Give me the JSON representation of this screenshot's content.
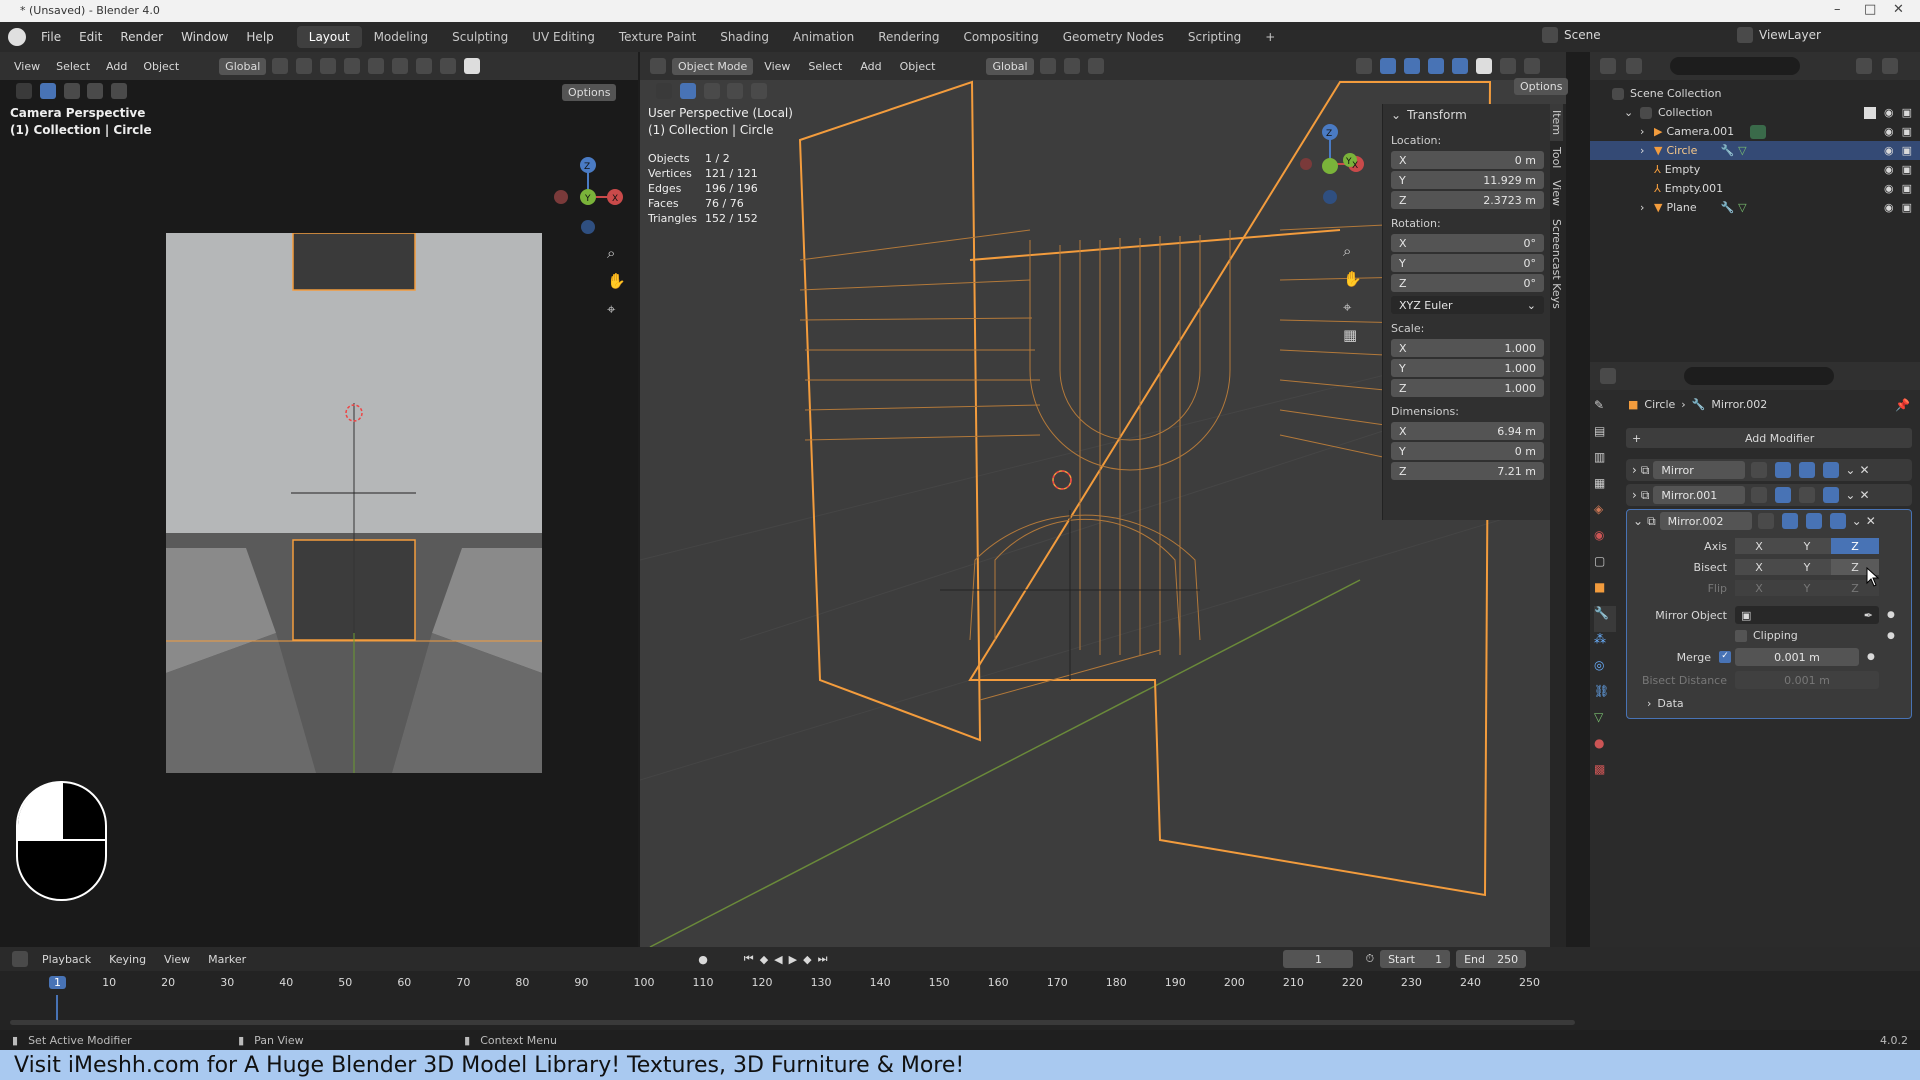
{
  "window": {
    "title": "* (Unsaved) - Blender 4.0"
  },
  "menu": [
    "File",
    "Edit",
    "Render",
    "Window",
    "Help"
  ],
  "workspaces": [
    "Layout",
    "Modeling",
    "Sculpting",
    "UV Editing",
    "Texture Paint",
    "Shading",
    "Animation",
    "Rendering",
    "Compositing",
    "Geometry Nodes",
    "Scripting"
  ],
  "workspace_add": "+",
  "scene": {
    "label": "Scene",
    "viewlayer": "ViewLayer"
  },
  "cam_view": {
    "menu": [
      "View",
      "Select",
      "Add",
      "Object"
    ],
    "transform": "Global",
    "options": "Options",
    "line1": "Camera Perspective",
    "line2": "(1) Collection | Circle"
  },
  "main_view": {
    "mode": "Object Mode",
    "menu": [
      "View",
      "Select",
      "Add",
      "Object"
    ],
    "transform": "Global",
    "options": "Options",
    "line1": "User Perspective (Local)",
    "line2": "(1) Collection | Circle",
    "stats": [
      {
        "k": "Objects",
        "v": "1 / 2"
      },
      {
        "k": "Vertices",
        "v": "121 / 121"
      },
      {
        "k": "Edges",
        "v": "196 / 196"
      },
      {
        "k": "Faces",
        "v": "76 / 76"
      },
      {
        "k": "Triangles",
        "v": "152 / 152"
      }
    ]
  },
  "npanel": {
    "title": "Transform",
    "location_label": "Location:",
    "location": [
      {
        "a": "X",
        "v": "0 m"
      },
      {
        "a": "Y",
        "v": "11.929 m"
      },
      {
        "a": "Z",
        "v": "2.3723 m"
      }
    ],
    "rotation_label": "Rotation:",
    "rotation": [
      {
        "a": "X",
        "v": "0°"
      },
      {
        "a": "Y",
        "v": "0°"
      },
      {
        "a": "Z",
        "v": "0°"
      }
    ],
    "euler": "XYZ Euler",
    "scale_label": "Scale:",
    "scale": [
      {
        "a": "X",
        "v": "1.000"
      },
      {
        "a": "Y",
        "v": "1.000"
      },
      {
        "a": "Z",
        "v": "1.000"
      }
    ],
    "dimensions_label": "Dimensions:",
    "dimensions": [
      {
        "a": "X",
        "v": "6.94 m"
      },
      {
        "a": "Y",
        "v": "0 m"
      },
      {
        "a": "Z",
        "v": "7.21 m"
      }
    ],
    "tabs": [
      "Item",
      "Tool",
      "View",
      "Screencast Keys"
    ]
  },
  "outliner": {
    "root": "Scene Collection",
    "collection": "Collection",
    "items": [
      "Camera.001",
      "Circle",
      "Empty",
      "Empty.001",
      "Plane"
    ],
    "selected": "Circle"
  },
  "properties": {
    "breadcrumb_obj": "Circle",
    "breadcrumb_mod": "Mirror.002",
    "add_modifier": "Add Modifier",
    "modifiers": [
      "Mirror",
      "Mirror.001",
      "Mirror.002"
    ],
    "axis_label": "Axis",
    "bisect_label": "Bisect",
    "flip_label": "Flip",
    "axes": [
      "X",
      "Y",
      "Z"
    ],
    "mirror_object_label": "Mirror Object",
    "clipping_label": "Clipping",
    "merge_label": "Merge",
    "merge_value": "0.001 m",
    "bisect_distance_label": "Bisect Distance",
    "bisect_distance_value": "0.001 m",
    "data_label": "Data"
  },
  "timeline": {
    "menu": [
      "Playback",
      "Keying",
      "View",
      "Marker"
    ],
    "current_frame": "1",
    "start_label": "Start",
    "start": "1",
    "end_label": "End",
    "end": "250",
    "ticks": [
      "1",
      "10",
      "20",
      "30",
      "40",
      "50",
      "60",
      "70",
      "80",
      "90",
      "100",
      "110",
      "120",
      "130",
      "140",
      "150",
      "160",
      "170",
      "180",
      "190",
      "200",
      "210",
      "220",
      "230",
      "240",
      "250"
    ]
  },
  "status": {
    "left": "Set Active Modifier",
    "middle": "Pan View",
    "right": "Context Menu",
    "version": "4.0.2"
  },
  "banner": {
    "text": "Visit iMeshh.com for A Huge Blender 3D Model Library! Textures, 3D Furniture & More!"
  },
  "colors": {
    "accent": "#4873b5",
    "selection": "#f39c3d",
    "banner": "#a9c9f0"
  }
}
